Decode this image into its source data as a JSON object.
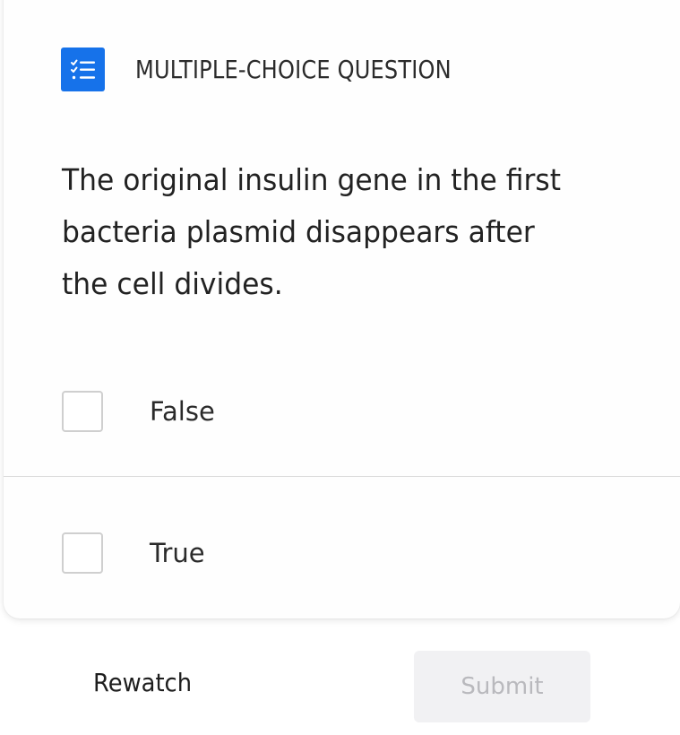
{
  "header": {
    "icon": "checklist-icon",
    "question_type": "MULTIPLE-CHOICE QUESTION"
  },
  "question": {
    "text": "The original insulin gene in the first bacteria plasmid disappears after the cell divides."
  },
  "options": [
    {
      "label": "False",
      "checked": false
    },
    {
      "label": "True",
      "checked": false
    }
  ],
  "actions": {
    "rewatch_label": "Rewatch",
    "submit_label": "Submit",
    "submit_enabled": false
  },
  "colors": {
    "accent": "#1672ea",
    "disabled_button_bg": "#f1f1f3",
    "disabled_button_text": "#b9b9bd"
  }
}
